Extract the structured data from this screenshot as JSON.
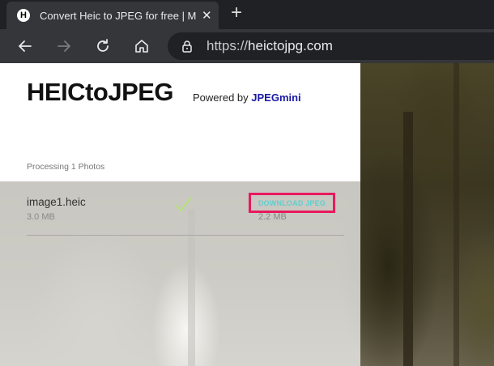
{
  "browser": {
    "tab": {
      "favicon_letter": "H",
      "title": "Convert Heic to JPEG for free | M",
      "close_glyph": "✕"
    },
    "new_tab_glyph": "+",
    "nav": {
      "back_icon": "back-arrow-icon",
      "forward_icon": "forward-arrow-icon",
      "reload_icon": "reload-icon",
      "home_icon": "home-icon"
    },
    "address": {
      "scheme": "https://",
      "host": "heictojpg.com"
    }
  },
  "page": {
    "brand": "HEICtoJPEG",
    "powered_prefix": "Powered by ",
    "powered_brand": "JPEGmini",
    "processing_label": "Processing 1 Photos",
    "files": [
      {
        "name": "image1.heic",
        "original_size": "3.0 MB",
        "status_icon": "checkmark-icon",
        "download_label": "DOWNLOAD JPEG",
        "new_size": "2.2 MB"
      }
    ]
  },
  "colors": {
    "highlight_border": "#e8195f",
    "download_text": "#5fcfcf",
    "check": "#b6e37a",
    "powered_brand": "#1a1aa6"
  }
}
